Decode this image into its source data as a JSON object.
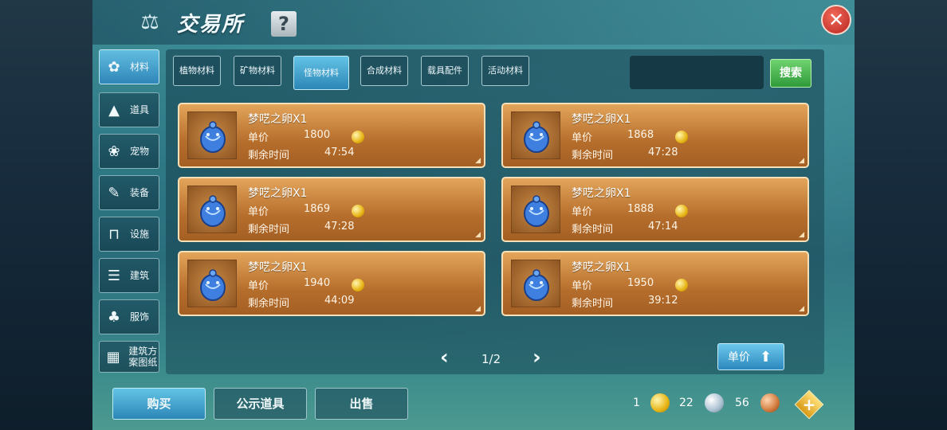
{
  "window": {
    "title": "交易所",
    "help_label": "?",
    "close_label": "✕"
  },
  "sidebar": {
    "items": [
      {
        "label": "材料",
        "icon": "materials-icon",
        "active": true
      },
      {
        "label": "道具",
        "icon": "item-icon",
        "active": false
      },
      {
        "label": "宠物",
        "icon": "paw-icon",
        "active": false
      },
      {
        "label": "装备",
        "icon": "equipment-icon",
        "active": false
      },
      {
        "label": "设施",
        "icon": "facility-icon",
        "active": false
      },
      {
        "label": "建筑",
        "icon": "building-icon",
        "active": false
      },
      {
        "label": "服饰",
        "icon": "clothing-icon",
        "active": false
      },
      {
        "label": "建筑方案图纸",
        "icon": "blueprint-icon",
        "active": false
      }
    ]
  },
  "tabs": [
    {
      "label": "植物材料",
      "active": false
    },
    {
      "label": "矿物材料",
      "active": false
    },
    {
      "label": "怪物材料",
      "active": true
    },
    {
      "label": "合成材料",
      "active": false
    },
    {
      "label": "载具配件",
      "active": false
    },
    {
      "label": "活动材料",
      "active": false
    }
  ],
  "search": {
    "placeholder": "",
    "button_label": "搜索"
  },
  "listings": [
    {
      "name": "梦呓之卵X1",
      "price_label": "单价",
      "price": "1800",
      "time_label": "剩余时间",
      "time": "47:54"
    },
    {
      "name": "梦呓之卵X1",
      "price_label": "单价",
      "price": "1868",
      "time_label": "剩余时间",
      "time": "47:28"
    },
    {
      "name": "梦呓之卵X1",
      "price_label": "单价",
      "price": "1869",
      "time_label": "剩余时间",
      "time": "47:28"
    },
    {
      "name": "梦呓之卵X1",
      "price_label": "单价",
      "price": "1888",
      "time_label": "剩余时间",
      "time": "47:14"
    },
    {
      "name": "梦呓之卵X1",
      "price_label": "单价",
      "price": "1940",
      "time_label": "剩余时间",
      "time": "44:09"
    },
    {
      "name": "梦呓之卵X1",
      "price_label": "单价",
      "price": "1950",
      "time_label": "剩余时间",
      "time": "39:12"
    }
  ],
  "pagination": {
    "current": "1/2"
  },
  "sort": {
    "label": "单价"
  },
  "bottom_tabs": [
    {
      "label": "购买",
      "active": true
    },
    {
      "label": "公示道具",
      "active": false
    },
    {
      "label": "出售",
      "active": false
    }
  ],
  "currency": {
    "gold": "1",
    "silver": "22",
    "copper": "56"
  },
  "colors": {
    "accent_blue": "#2c86b6",
    "card_orange": "#b66e2c",
    "search_green": "#2f9a3a",
    "close_red": "#b8231d"
  }
}
